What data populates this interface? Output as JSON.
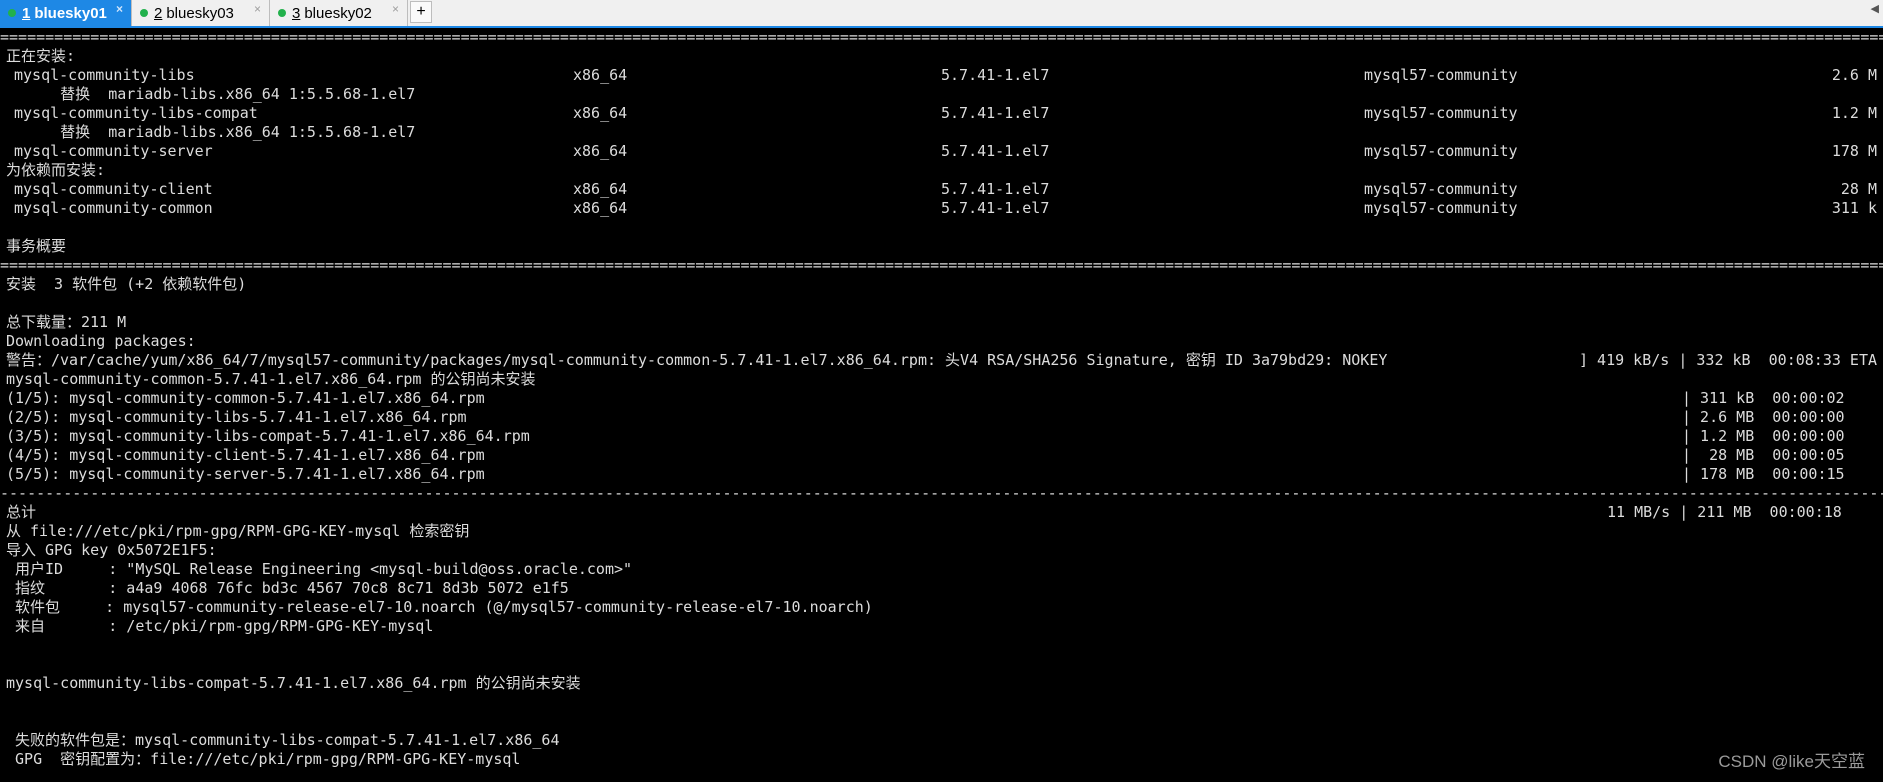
{
  "tabs": [
    {
      "num": "1",
      "label": "bluesky01",
      "active": true
    },
    {
      "num": "2",
      "label": "bluesky03",
      "active": false
    },
    {
      "num": "3",
      "label": "bluesky02",
      "active": false
    }
  ],
  "tab_close_glyph": "×",
  "add_tab_glyph": "+",
  "scroll_glyph": "◀",
  "rule_eq": "================================================================================================================================================================================================================================================",
  "rule_dash": "------------------------------------------------------------------------------------------------------------------------------------------------------------------------------------------------------------------------------------------------",
  "installing_header": "正在安装:",
  "packages": [
    {
      "name": "mysql-community-libs",
      "arch": "x86_64",
      "version": "5.7.41-1.el7",
      "repo": "mysql57-community",
      "size": "2.6 M"
    },
    {
      "name": "mysql-community-libs-compat",
      "arch": "x86_64",
      "version": "5.7.41-1.el7",
      "repo": "mysql57-community",
      "size": "1.2 M"
    },
    {
      "name": "mysql-community-server",
      "arch": "x86_64",
      "version": "5.7.41-1.el7",
      "repo": "mysql57-community",
      "size": "178 M"
    }
  ],
  "replace_lines": [
    "      替换  mariadb-libs.x86_64 1:5.5.68-1.el7",
    "      替换  mariadb-libs.x86_64 1:5.5.68-1.el7"
  ],
  "deps_header": "为依赖而安装:",
  "deps": [
    {
      "name": "mysql-community-client",
      "arch": "x86_64",
      "version": "5.7.41-1.el7",
      "repo": "mysql57-community",
      "size": "28 M"
    },
    {
      "name": "mysql-community-common",
      "arch": "x86_64",
      "version": "5.7.41-1.el7",
      "repo": "mysql57-community",
      "size": "311 k"
    }
  ],
  "summary_header": "事务概要",
  "install_summary": "安装  3 软件包 (+2 依赖软件包)",
  "total_download": "总下载量：211 M",
  "downloading": "Downloading packages:",
  "warning_line": "警告：/var/cache/yum/x86_64/7/mysql57-community/packages/mysql-community-common-5.7.41-1.el7.x86_64.rpm: 头V4 RSA/SHA256 Signature, 密钥 ID 3a79bd29: NOKEY",
  "warning_progress": "] 419 kB/s | 332 kB  00:08:33 ETA",
  "nokey_line": "mysql-community-common-5.7.41-1.el7.x86_64.rpm 的公钥尚未安装",
  "downloads": [
    {
      "file": "(1/5): mysql-community-common-5.7.41-1.el7.x86_64.rpm",
      "stat": "| 311 kB  00:00:02"
    },
    {
      "file": "(2/5): mysql-community-libs-5.7.41-1.el7.x86_64.rpm",
      "stat": "| 2.6 MB  00:00:00"
    },
    {
      "file": "(3/5): mysql-community-libs-compat-5.7.41-1.el7.x86_64.rpm",
      "stat": "| 1.2 MB  00:00:00"
    },
    {
      "file": "(4/5): mysql-community-client-5.7.41-1.el7.x86_64.rpm",
      "stat": "|  28 MB  00:00:05"
    },
    {
      "file": "(5/5): mysql-community-server-5.7.41-1.el7.x86_64.rpm",
      "stat": "| 178 MB  00:00:15"
    }
  ],
  "total_label": "总计",
  "total_stat": "11 MB/s | 211 MB  00:00:18",
  "key_lines": [
    "从 file:///etc/pki/rpm-gpg/RPM-GPG-KEY-mysql 检索密钥",
    "导入 GPG key 0x5072E1F5:",
    " 用户ID     : \"MySQL Release Engineering <mysql-build@oss.oracle.com>\"",
    " 指纹       : a4a9 4068 76fc bd3c 4567 70c8 8c71 8d3b 5072 e1f5",
    " 软件包     : mysql57-community-release-el7-10.noarch (@/mysql57-community-release-el7-10.noarch)",
    " 来自       : /etc/pki/rpm-gpg/RPM-GPG-KEY-mysql"
  ],
  "compat_nokey": "mysql-community-libs-compat-5.7.41-1.el7.x86_64.rpm 的公钥尚未安装",
  "failed_line": " 失败的软件包是：mysql-community-libs-compat-5.7.41-1.el7.x86_64",
  "gpg_line": " GPG  密钥配置为：file:///etc/pki/rpm-gpg/RPM-GPG-KEY-mysql",
  "watermark": "CSDN @like天空蓝"
}
